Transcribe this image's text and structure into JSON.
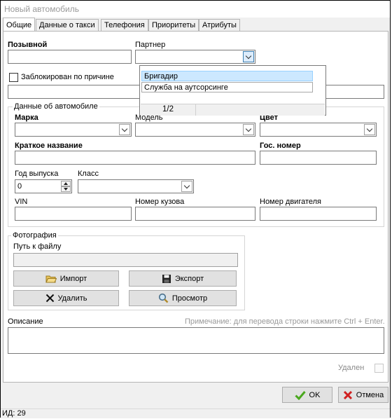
{
  "window": {
    "title": "Новый автомобиль"
  },
  "tabs": [
    {
      "label": "Общие",
      "active": true
    },
    {
      "label": "Данные о такси"
    },
    {
      "label": "Телефония"
    },
    {
      "label": "Приоритеты"
    },
    {
      "label": "Атрибуты"
    }
  ],
  "general": {
    "callsign_label": "Позывной",
    "callsign_value": "",
    "partner_label": "Партнер",
    "partner_value": "",
    "blocked_label": "Заблокирован по причине",
    "blocked_reason": ""
  },
  "partner_popup": {
    "items": [
      "Бригадир",
      "Служба на аутсорсинге"
    ],
    "selected_index": 0,
    "pager": "1/2"
  },
  "car_group": {
    "title": "Данные об автомобиле",
    "brand_label": "Марка",
    "model_label": "Модель",
    "color_label": "Цвет",
    "short_name_label": "Краткое название",
    "plate_label": "Гос. номер",
    "year_label": "Год выпуска",
    "year_value": "0",
    "class_label": "Класс",
    "vin_label": "VIN",
    "body_label": "Номер кузова",
    "engine_label": "Номер двигателя"
  },
  "photo_group": {
    "title": "Фотография",
    "path_label": "Путь к файлу",
    "path_value": "",
    "import_label": "Импорт",
    "export_label": "Экспорт",
    "delete_label": "Удалить",
    "view_label": "Просмотр"
  },
  "description": {
    "label": "Описание",
    "hint": "Примечание: для перевода строки нажмите Ctrl + Enter.",
    "value": ""
  },
  "deleted_label": "Удален",
  "buttons": {
    "ok": "OK",
    "cancel": "Отмена"
  },
  "status": {
    "id_text": "ИД: 29"
  },
  "colors": {
    "accent": "#0078d7",
    "ok_green": "#3a9a1c",
    "cancel_red": "#d02020"
  }
}
